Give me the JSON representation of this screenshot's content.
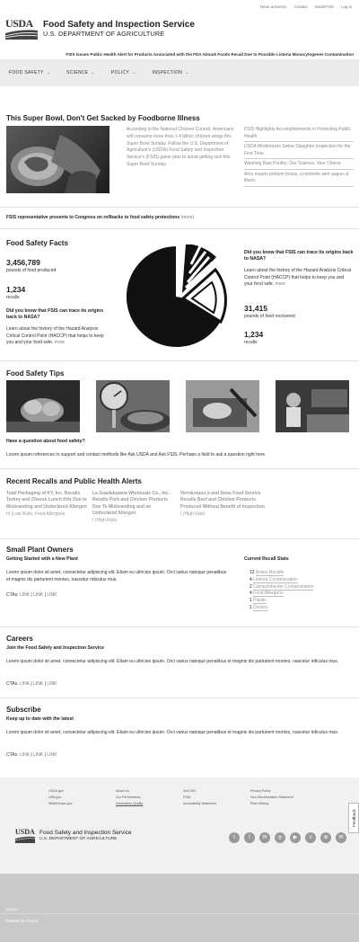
{
  "top_links": [
    "News & Events",
    "Contact",
    "InsideFSIS",
    "Log in"
  ],
  "logo_text": "USDA",
  "agency_name": "Food Safety and Inspection Service",
  "department": "U.S. DEPARTMENT OF AGRICULTURE",
  "alert": "FSIS Issues Public Health Alert for Products Associated with the FDA Almark Foods Recall Due to Possible Listeria Monocytogenes Contamination",
  "nav": [
    "FOOD SAFETY",
    "SCIENCE",
    "POLICY",
    "INSPECTION"
  ],
  "featured": {
    "title": "This Super Bowl, Don't Get Sacked by Foodborne Illness",
    "text": "According to the National Chicken Council, Americans will consume more than 1.4 billion chicken wings this Super Bowl Sunday. Follow the U.S. Department of Agriculture's (USDA) Food Safety and Inspection Service's (FSIS) game plan to avoid getting sick this Super Bowl Sunday.",
    "links": [
      "FSIS Highlights Accomplishments in Protecting Public Health",
      "USDA Modernizes Swine Slaughter Inspection for the First Time",
      "Washing Raw Poultry: Our Science, Your Choice",
      "Arcu mauris pretium lectus, a molestie sem augue ut libero."
    ]
  },
  "headline": {
    "text": "FSIS representative presents to Congress on rollbacks to food safety protections",
    "more": "(more)"
  },
  "facts": {
    "title": "Food Safety Facts",
    "left": [
      {
        "num": "3,456,789",
        "label": "pounds of food produced"
      },
      {
        "num": "1,234",
        "label": "recalls"
      }
    ],
    "left_q": "Did you know that FSIS can trace its origins back to NASA?",
    "left_text": "Learn about the history of the Hazard Analysis Critical Control Point (HACCP) that helps to keep you and your food safe.",
    "more": "more",
    "right_q": "Did you know that FSIS can trace its origins back to NASA?",
    "right_text": "Learn about the history of the Hazard Analysis Critical Control Point (HACCP) that helps to keep you and your food safe.",
    "right": [
      {
        "num": "31,415",
        "label": "pounds of food recovered"
      },
      {
        "num": "1,234",
        "label": "recalls"
      }
    ]
  },
  "tips": {
    "title": "Food Safety Tips",
    "question": "Have a question about food safety?",
    "text": "Lorem ipsum references to support and contact methods like Ask USDA and Ask FSIS. Perhaps a field to ask a question right here."
  },
  "recalls": {
    "title": "Recent Recalls and Public Health Alerts",
    "items": [
      {
        "title": "Total Packaging of KY, Inc. Recalls Turkey and Cheese Lunch Kits Due to Misbranding and Undeclared Allergen",
        "meta": "III (Low Risk), Food Allergens"
      },
      {
        "title": "La Guadalupana Wholesale Co., Inc. Recalls Pork and Chicken Products Due To Misbranding and an Undeclared Allergen",
        "meta": "I (High Risk)"
      },
      {
        "title": "Vern&rsquo;s and Sons Food Service Recalls Beef and Chicken Products Produced Without Benefit of Inspection",
        "meta": "I (High Risk)"
      }
    ]
  },
  "small_plant": {
    "title": "Small Plant Owners",
    "subtitle": "Getting Started with a New Plant",
    "text": "Lorem ipsum dolor sit amet, consectetur adipiscing elit. Etiam eu ultricies ipsum. Orci varius natoque penatibus et magnis dis parturient montes, nascetur ridiculus mus.",
    "ctas_label": "CTAs:",
    "ctas": [
      "LINK",
      "LINK",
      "LINK"
    ],
    "stats_title": "Current Recall Stats",
    "stats": [
      {
        "n": "12",
        "label": "Active Recalls"
      },
      {
        "n": "4",
        "label": "Listeria Contamination"
      },
      {
        "n": "2",
        "label": "Campylobacter Contamination"
      },
      {
        "n": "4",
        "label": "Food Allergens"
      },
      {
        "n": "1",
        "label": "Plastic"
      },
      {
        "n": "1",
        "label": "Dioxins"
      }
    ]
  },
  "careers": {
    "title": "Careers",
    "subtitle": "Join the Food Safety and Inspection Service",
    "text": "Lorem ipsum dolor sit amet, consectetur adipiscing elit. Etiam eu ultricies ipsum. Orci varius natoque penatibus et magnis dis parturient montes, nascetur ridiculus mus.",
    "ctas_label": "CTAs:",
    "ctas": [
      "LINK",
      "LINK",
      "LINK"
    ]
  },
  "subscribe": {
    "title": "Subscribe",
    "subtitle": "Keep up to date with the latest",
    "text": "Lorem ipsum dolor sit amet, consectetur adipiscing elit. Etiam eu ultricies ipsum. Orci varius natoque penatibus et magnis dis parturient montes, nascetur ridiculus mus.",
    "ctas_label": "CTAs:",
    "ctas": [
      "LINK",
      "LINK",
      "LINK"
    ]
  },
  "footer": {
    "cols": [
      [
        "USDA.gov",
        "USA.gov",
        "WhiteHouse.gov"
      ],
      [
        "About Us",
        "Our Performance",
        "Information Quality"
      ],
      [
        "Visit OIG",
        "FOIA",
        "Accessibility Statement"
      ],
      [
        "Privacy Policy",
        "Non-Discrimination Statement",
        "Plain Writing"
      ]
    ],
    "agency_name": "Food Safety and Inspection Service",
    "department": "U.S. DEPARTMENT OF AGRICULTURE",
    "social": [
      "t",
      "f",
      "✉",
      "◎",
      "▶",
      "≡",
      "⊕",
      "✉"
    ],
    "feedback": "Feedback"
  },
  "bottom": {
    "contact": "Contact",
    "powered": "Powered by Drupal"
  }
}
